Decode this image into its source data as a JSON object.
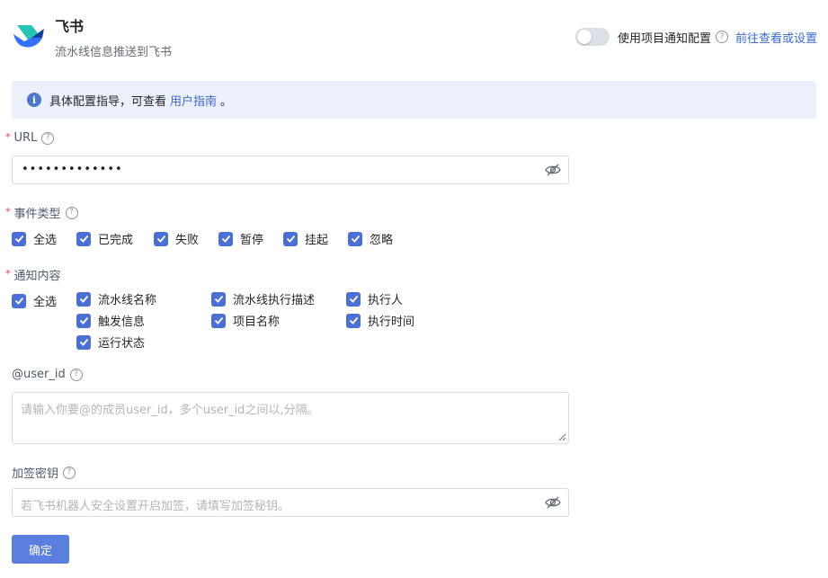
{
  "header": {
    "title": "飞书",
    "subtitle": "流水线信息推送到飞书",
    "toggle_label": "使用项目通知配置",
    "settings_link": "前往查看或设置"
  },
  "info": {
    "text_before": "具体配置指导，可查看",
    "link": "用户指南",
    "text_after": "。"
  },
  "url": {
    "label": "URL",
    "value": "•••••••••••••"
  },
  "event_type": {
    "label": "事件类型",
    "options": [
      "全选",
      "已完成",
      "失败",
      "暂停",
      "挂起",
      "忽略"
    ]
  },
  "notify_content": {
    "label": "通知内容",
    "select_all": "全选",
    "options": [
      "流水线名称",
      "流水线执行描述",
      "执行人",
      "触发信息",
      "项目名称",
      "执行时间",
      "运行状态"
    ]
  },
  "user_id": {
    "label": "@user_id",
    "placeholder": "请输入你要@的成员user_id，多个user_id之间以,分隔。"
  },
  "secret": {
    "label": "加签密钥",
    "placeholder": "若飞书机器人安全设置开启加签，请填写加签秘钥。"
  },
  "confirm_label": "确定",
  "colors": {
    "accent": "#4b6fd8",
    "link": "#3b6ad1",
    "required": "#e2453c",
    "info_bg": "#ecf0fb"
  }
}
